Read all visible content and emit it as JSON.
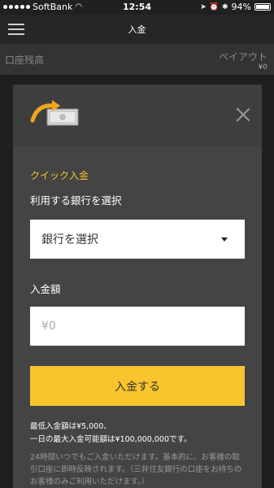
{
  "status_bar": {
    "carrier": "SoftBank",
    "time": "12:54",
    "battery_percent": "94%"
  },
  "header": {
    "title": "入金",
    "menu_icon": "hamburger-menu-icon"
  },
  "balance_bar": {
    "left_label": "口座残高",
    "right_label": "ペイアウト",
    "right_value": "¥0"
  },
  "modal": {
    "icon": "money-transfer-icon",
    "section_title": "クイック入金",
    "bank_label": "利用する銀行を選択",
    "bank_select_value": "銀行を選択",
    "amount_label": "入金額",
    "amount_placeholder": "¥0",
    "deposit_button": "入金する",
    "note_line1": "最低入金額は¥5,000、",
    "note_line2": "一日の最大入金可能額は¥100,000,000です。",
    "note_gray": "24時間いつでもご入金いただけます。基本的に、お客様の取引口座に即時反映されます。（三井住友銀行の口座をお持ちのお客様のみご利用いただけます。）"
  },
  "colors": {
    "accent": "#f8c52e",
    "section_title": "#f5c12d"
  }
}
